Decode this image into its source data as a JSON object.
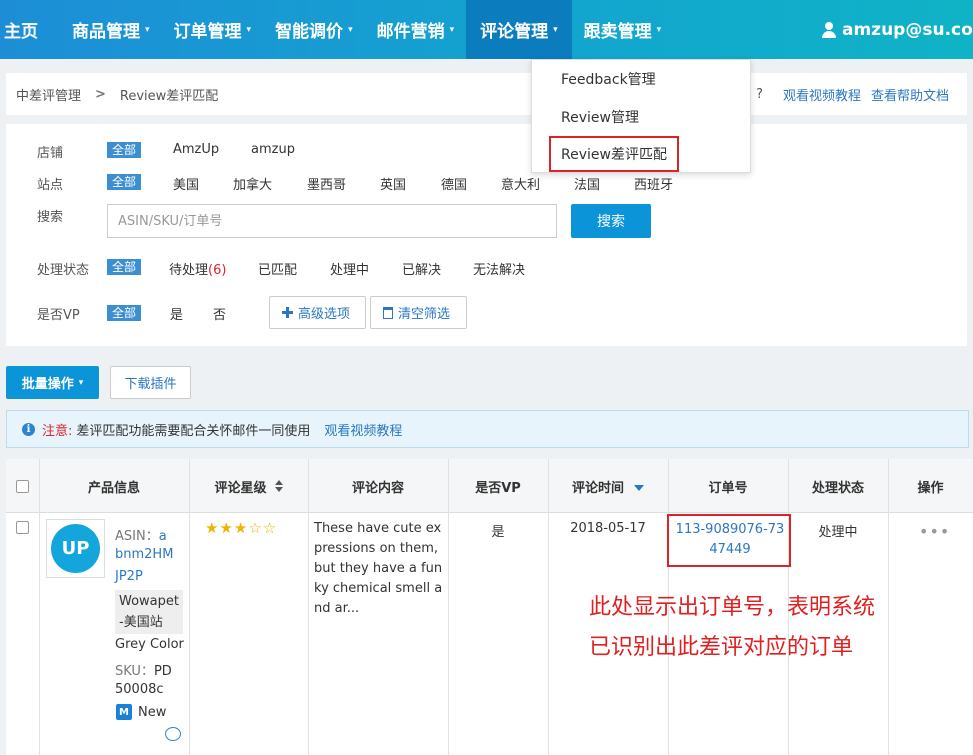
{
  "nav": {
    "items": [
      {
        "label": "主页",
        "caret": false
      },
      {
        "label": "商品管理",
        "caret": true
      },
      {
        "label": "订单管理",
        "caret": true
      },
      {
        "label": "智能调价",
        "caret": true
      },
      {
        "label": "邮件营销",
        "caret": true
      },
      {
        "label": "评论管理",
        "caret": true,
        "active": true
      },
      {
        "label": "跟卖管理",
        "caret": true
      }
    ],
    "user": "amzup@su.com",
    "caret_glyph": "▾"
  },
  "dropdown": {
    "items": [
      "Feedback管理",
      "Review管理",
      "Review差评匹配"
    ]
  },
  "breadcrumb": {
    "parent": "中差评管理",
    "current": "Review差评匹配",
    "separator": ">"
  },
  "help": {
    "question": "?",
    "video_link": "观看视频教程",
    "doc_link": "查看帮助文档"
  },
  "filters": {
    "shop": {
      "label": "店铺",
      "all": "全部",
      "options": [
        "AmzUp",
        "amzup"
      ]
    },
    "site": {
      "label": "站点",
      "all": "全部",
      "options": [
        "美国",
        "加拿大",
        "墨西哥",
        "英国",
        "德国",
        "意大利",
        "法国",
        "西班牙"
      ]
    },
    "search": {
      "label": "搜索",
      "placeholder": "ASIN/SKU/订单号",
      "button": "搜索"
    },
    "status": {
      "label": "处理状态",
      "all": "全部",
      "pending_label": "待处理",
      "pending_count": "(6)",
      "options": [
        "已匹配",
        "处理中",
        "已解决",
        "无法解决"
      ]
    },
    "vp": {
      "label": "是否VP",
      "all": "全部",
      "options": [
        "是",
        "否"
      ]
    },
    "advanced_button": "高级选项",
    "clear_button": "清空筛选"
  },
  "actions": {
    "batch": "批量操作",
    "download_plugin": "下载插件"
  },
  "notice": {
    "label": "注意:",
    "text": "差评匹配功能需要配合关怀邮件一同使用",
    "link": "观看视频教程"
  },
  "table": {
    "headers": [
      "产品信息",
      "评论星级",
      "评论内容",
      "是否VP",
      "评论时间",
      "订单号",
      "处理状态",
      "操作"
    ],
    "rows": [
      {
        "logo_text": "UP",
        "asin_label": "ASIN：",
        "asin_line1": "a",
        "asin_line2": "bnm2HM",
        "asin_line3": "JP2P",
        "store_line1": "Wowapet",
        "store_line2": "-美国站",
        "color": "Grey Color",
        "sku_label": "SKU：",
        "sku_line1": "PD",
        "sku_line2": "50008c",
        "condition": "New",
        "condition_icon": "M",
        "rating": 3,
        "stars_filled": "★★★",
        "stars_empty": "☆☆",
        "review": "These have cute expressions on them, but they have a funky chemical smell and ar...",
        "vp": "是",
        "date": "2018-05-17",
        "order": "113-9089076-7347449",
        "status": "处理中",
        "more": "•••"
      }
    ]
  },
  "annotation": {
    "line1": "此处显示出订单号，表明系统",
    "line2": "已识别出此差评对应的订单"
  },
  "colors": {
    "nav_start": "#1d8ed6",
    "nav_end": "#10b3c6",
    "primary": "#0b95d8",
    "link": "#2a78c3",
    "highlight": "#d9252a",
    "star": "#f0b400"
  }
}
